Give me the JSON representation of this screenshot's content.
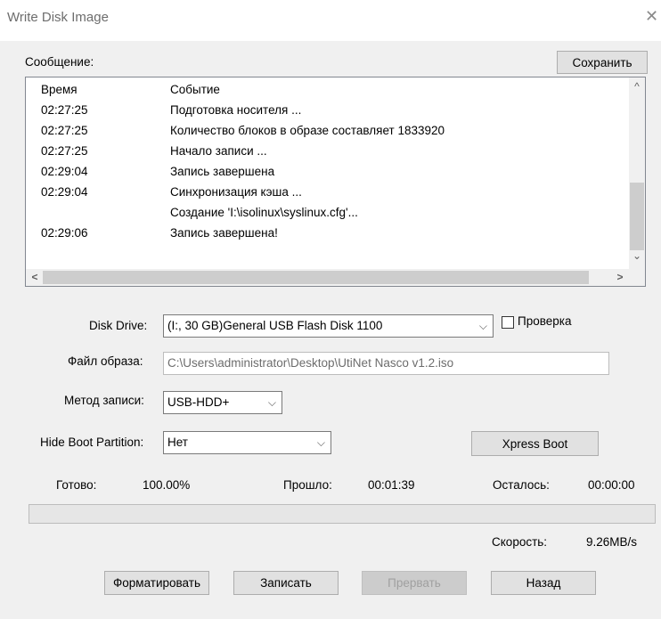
{
  "window": {
    "title": "Write Disk Image",
    "close_icon": "close-icon"
  },
  "message": {
    "label": "Сообщение:",
    "save_button": "Сохранить"
  },
  "log": {
    "headers": [
      "Время",
      "Событие"
    ],
    "rows": [
      [
        "02:27:25",
        "Подготовка носителя ..."
      ],
      [
        "02:27:25",
        "Количество блоков в образе составляет 1833920"
      ],
      [
        "02:27:25",
        "Начало записи ..."
      ],
      [
        "02:29:04",
        "Запись завершена"
      ],
      [
        "02:29:04",
        "Синхронизация кэша ..."
      ],
      [
        "",
        "Создание 'I:\\isolinux\\syslinux.cfg'..."
      ],
      [
        "02:29:06",
        "Запись завершена!"
      ]
    ]
  },
  "disk_drive": {
    "label": "Disk Drive:",
    "value": "(I:, 30 GB)General USB Flash Disk  1100",
    "verify_label": "Проверка",
    "verify_checked": false
  },
  "image_file": {
    "label": "Файл образа:",
    "value": "C:\\Users\\administrator\\Desktop\\UtiNet Nasco v1.2.iso"
  },
  "write_method": {
    "label": "Метод записи:",
    "value": "USB-HDD+"
  },
  "hide_boot": {
    "label": "Hide Boot Partition:",
    "value": "Нет"
  },
  "xpress_boot": "Xpress Boot",
  "status": {
    "done_label": "Готово:",
    "done_value": "100.00%",
    "elapsed_label": "Прошло:",
    "elapsed_value": "00:01:39",
    "remaining_label": "Осталось:",
    "remaining_value": "00:00:00",
    "speed_label": "Скорость:",
    "speed_value": "9.26MB/s",
    "progress_fraction": 0
  },
  "buttons": {
    "format": "Форматировать",
    "write": "Записать",
    "abort": "Прервать",
    "back": "Назад"
  }
}
